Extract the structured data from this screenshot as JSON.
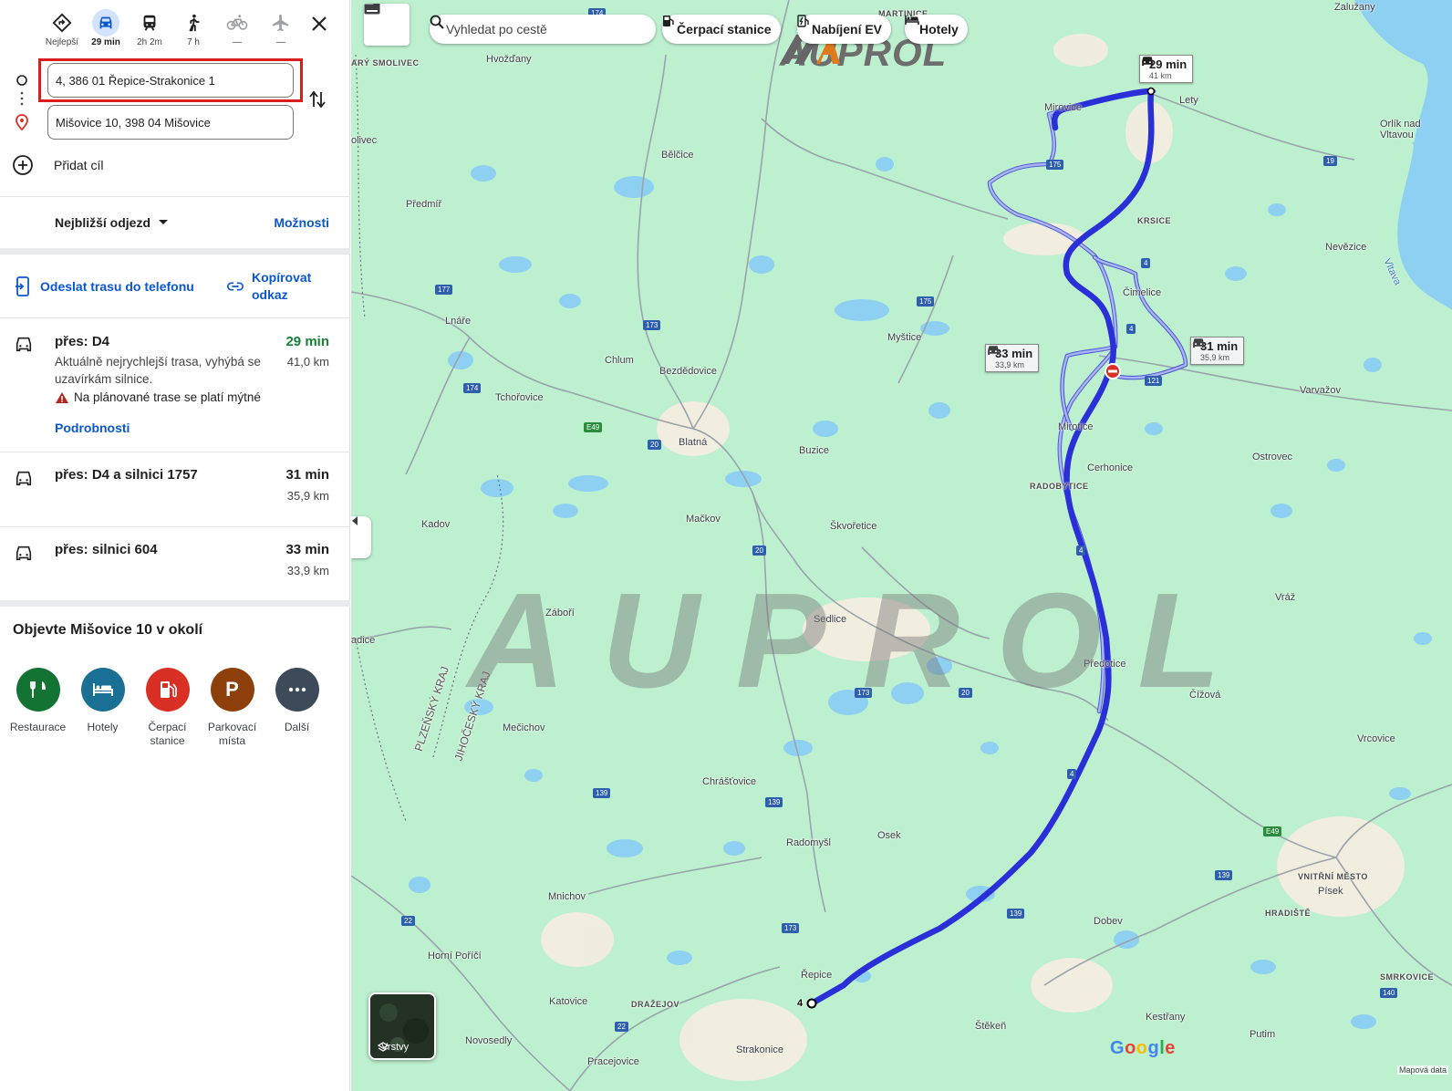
{
  "modes": [
    {
      "name": "mode-best",
      "label": "Nejlepší",
      "icon": "diamond-route-icon",
      "active": false
    },
    {
      "name": "mode-car",
      "label": "29 min",
      "icon": "car-icon",
      "active": true
    },
    {
      "name": "mode-transit",
      "label": "2h 2m",
      "icon": "train-icon",
      "active": false
    },
    {
      "name": "mode-walk",
      "label": "7 h",
      "icon": "walk-icon",
      "active": false
    },
    {
      "name": "mode-bike",
      "label": "—",
      "icon": "bike-icon",
      "active": false
    },
    {
      "name": "mode-flight",
      "label": "—",
      "icon": "plane-icon",
      "active": false
    }
  ],
  "directions": {
    "origin": "4, 386 01 Řepice-Strakonice 1",
    "destination": "Mišovice 10, 398 04 Mišovice",
    "add_stop": "Přidat cíl",
    "depart": "Nejbližší odjezd",
    "options": "Možnosti",
    "send_to_phone": "Odeslat trasu do telefonu",
    "copy_link": "Kopírovat odkaz"
  },
  "routes": [
    {
      "via": "přes: D4",
      "time": "29 min",
      "distance": "41,0 km",
      "description": "Aktuálně nejrychlejší trasa, vyhýbá se uzavírkám silnice.",
      "toll": "Na plánované trase se platí mýtné",
      "details": "Podrobnosti",
      "time_color": "#188038"
    },
    {
      "via": "přes: D4 a silnici 1757",
      "time": "31 min",
      "distance": "35,9 km"
    },
    {
      "via": "přes: silnici 604",
      "time": "33 min",
      "distance": "33,9 km"
    }
  ],
  "explore": {
    "title": "Objevte Mišovice 10 v okolí",
    "categories": [
      {
        "label": "Restaurace",
        "color": "#137333",
        "icon": "fork-knife-icon"
      },
      {
        "label": "Hotely",
        "color": "#1a6f94",
        "icon": "bed-icon"
      },
      {
        "label": "Čerpací stanice",
        "color": "#d93025",
        "icon": "gas-pump-icon"
      },
      {
        "label": "Parkovací místa",
        "color": "#8d3f0c",
        "icon": "parking-icon"
      },
      {
        "label": "Další",
        "color": "#3c4a5a",
        "icon": "more-icon"
      }
    ]
  },
  "map": {
    "search_placeholder": "Vyhledat po cestě",
    "chips": [
      "Čerpací stanice",
      "Nabíjení EV",
      "Hotely"
    ],
    "route_labels": [
      {
        "time": "29 min",
        "distance": "41 km"
      },
      {
        "time": "33 min",
        "distance": "33,9 km"
      },
      {
        "time": "31 min",
        "distance": "35,9 km"
      }
    ],
    "layers": "Vrstvy",
    "google": "Google",
    "map_data": "Mapová data",
    "watermark": "AUPROL",
    "logo": "AUPROL",
    "start_marker": "4",
    "places": [
      {
        "t": "Zalužany",
        "c": false
      },
      {
        "t": "MARTINICE",
        "c": true
      },
      {
        "t": "ARÝ SMOLIVEC",
        "c": true
      },
      {
        "t": "Hvožďany",
        "c": false
      },
      {
        "t": "Mirovice",
        "c": false
      },
      {
        "t": "Lety",
        "c": false
      },
      {
        "t": "Orlík nad Vltavou",
        "c": false
      },
      {
        "t": "olivec",
        "c": false
      },
      {
        "t": "Bělčice",
        "c": false
      },
      {
        "t": "Předmíř",
        "c": false
      },
      {
        "t": "KRSICE",
        "c": true
      },
      {
        "t": "Nevězice",
        "c": false
      },
      {
        "t": "Čimelice",
        "c": false
      },
      {
        "t": "Lnáře",
        "c": false
      },
      {
        "t": "Myštice",
        "c": false
      },
      {
        "t": "Chlum",
        "c": false
      },
      {
        "t": "Bezdědovice",
        "c": false
      },
      {
        "t": "Varvažov",
        "c": false
      },
      {
        "t": "Tchořovice",
        "c": false
      },
      {
        "t": "Mirotice",
        "c": false
      },
      {
        "t": "Blatná",
        "c": false
      },
      {
        "t": "Buzice",
        "c": false
      },
      {
        "t": "Ostrovec",
        "c": false
      },
      {
        "t": "Cerhonice",
        "c": false
      },
      {
        "t": "RADOBYTICE",
        "c": true
      },
      {
        "t": "Kadov",
        "c": false
      },
      {
        "t": "Mačkov",
        "c": false
      },
      {
        "t": "Škvořetice",
        "c": false
      },
      {
        "t": "Záboří",
        "c": false
      },
      {
        "t": "Sedlice",
        "c": false
      },
      {
        "t": "Vráž",
        "c": false
      },
      {
        "t": "adice",
        "c": false
      },
      {
        "t": "Předotice",
        "c": false
      },
      {
        "t": "Čížová",
        "c": false
      },
      {
        "t": "Mečichov",
        "c": false
      },
      {
        "t": "Vrcovice",
        "c": false
      },
      {
        "t": "Chrášťovice",
        "c": false
      },
      {
        "t": "Radomyšl",
        "c": false
      },
      {
        "t": "Osek",
        "c": false
      },
      {
        "t": "VNITŘNÍ MĚSTO",
        "c": true
      },
      {
        "t": "Písek",
        "c": false
      },
      {
        "t": "HRADIŠTĚ",
        "c": true
      },
      {
        "t": "Mnichov",
        "c": false
      },
      {
        "t": "Dobev",
        "c": false
      },
      {
        "t": "Horní Poříčí",
        "c": false
      },
      {
        "t": "Řepice",
        "c": false
      },
      {
        "t": "SMRKOVICE",
        "c": true
      },
      {
        "t": "Katovice",
        "c": false
      },
      {
        "t": "DRAŽEJOV",
        "c": true
      },
      {
        "t": "Kestřany",
        "c": false
      },
      {
        "t": "Štěkeň",
        "c": false
      },
      {
        "t": "Novosedly",
        "c": false
      },
      {
        "t": "Strakonice",
        "c": false
      },
      {
        "t": "Putim",
        "c": false
      },
      {
        "t": "Pracejovice",
        "c": false
      },
      {
        "t": "Vltava",
        "c": false
      }
    ],
    "regions": [
      "PLZEŇSKÝ KRAJ",
      "JIHOČESKÝ KRAJ"
    ],
    "shields": [
      {
        "t": "174",
        "e": false
      },
      {
        "t": "175",
        "e": false
      },
      {
        "t": "19",
        "e": false
      },
      {
        "t": "177",
        "e": false
      },
      {
        "t": "175",
        "e": false
      },
      {
        "t": "173",
        "e": false
      },
      {
        "t": "174",
        "e": false
      },
      {
        "t": "E49",
        "e": true
      },
      {
        "t": "20",
        "e": false
      },
      {
        "t": "121",
        "e": false
      },
      {
        "t": "4",
        "e": false
      },
      {
        "t": "4",
        "e": false
      },
      {
        "t": "20",
        "e": false
      },
      {
        "t": "173",
        "e": false
      },
      {
        "t": "20",
        "e": false
      },
      {
        "t": "139",
        "e": false
      },
      {
        "t": "139",
        "e": false
      },
      {
        "t": "E49",
        "e": true
      },
      {
        "t": "139",
        "e": false
      },
      {
        "t": "139",
        "e": false
      },
      {
        "t": "22",
        "e": false
      },
      {
        "t": "173",
        "e": false
      },
      {
        "t": "140",
        "e": false
      },
      {
        "t": "22",
        "e": false
      },
      {
        "t": "4",
        "e": false
      },
      {
        "t": "4",
        "e": false
      }
    ]
  }
}
